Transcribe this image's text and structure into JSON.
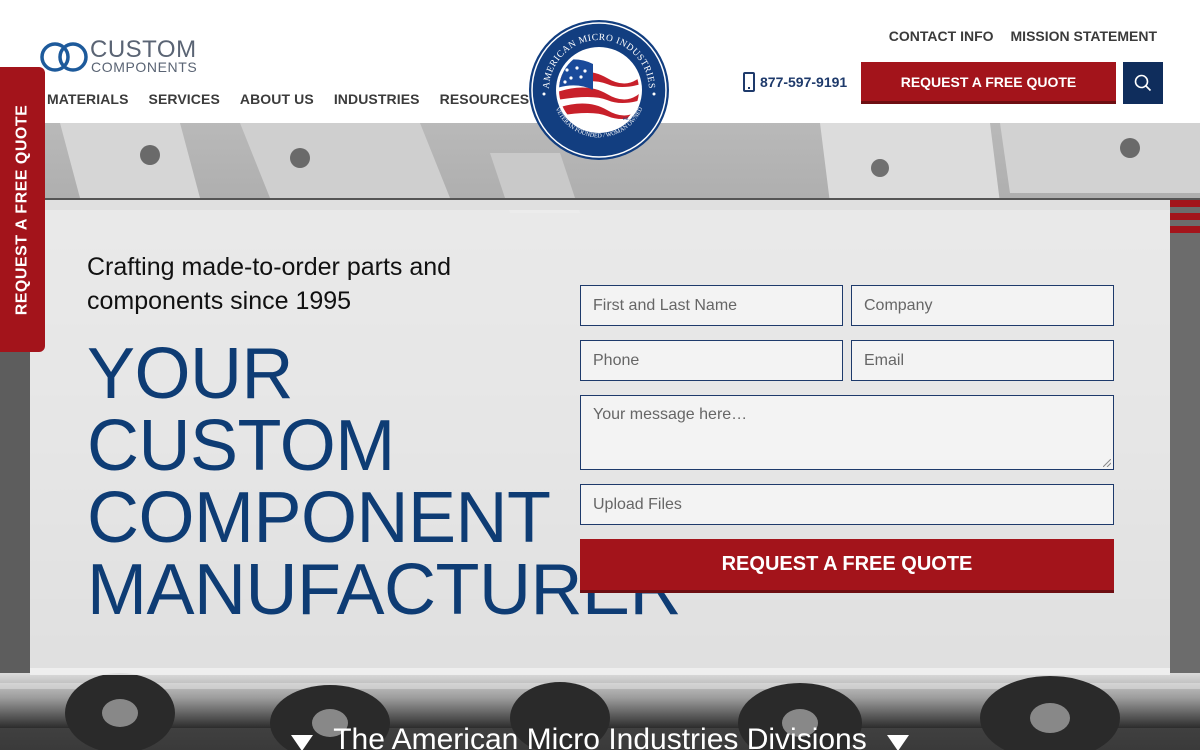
{
  "brand": {
    "logo_line1": "CUSTOM",
    "logo_line2": "COMPONENTS",
    "seal_text_top": "AMERICAN MICRO INDUSTRIES",
    "seal_text_bottom": "VETERAN FOUNDED / WOMAN OWNED",
    "seal_est": "est. 1995"
  },
  "nav": {
    "items": [
      "MATERIALS",
      "SERVICES",
      "ABOUT US",
      "INDUSTRIES",
      "RESOURCES"
    ]
  },
  "utility": {
    "contact": "CONTACT INFO",
    "mission": "MISSION STATEMENT"
  },
  "header": {
    "phone": "877-597-9191",
    "quote_button": "REQUEST A FREE QUOTE",
    "search_icon": "search-icon"
  },
  "side_tab": {
    "label": "REQUEST A FREE QUOTE"
  },
  "hero": {
    "tagline": "Crafting made-to-order parts and components since 1995",
    "headline": [
      "YOUR",
      "CUSTOM",
      "COMPONENT",
      "MANUFACTURER"
    ]
  },
  "form": {
    "name_placeholder": "First and Last Name",
    "company_placeholder": "Company",
    "phone_placeholder": "Phone",
    "email_placeholder": "Email",
    "message_placeholder": "Your message here…",
    "upload_label": "Upload Files",
    "submit_label": "REQUEST A FREE QUOTE"
  },
  "divisions": {
    "title": "The American Micro Industries Divisions"
  },
  "colors": {
    "brand_red": "#a3141b",
    "brand_navy": "#0e3c74",
    "header_navy": "#0f2d5c"
  }
}
